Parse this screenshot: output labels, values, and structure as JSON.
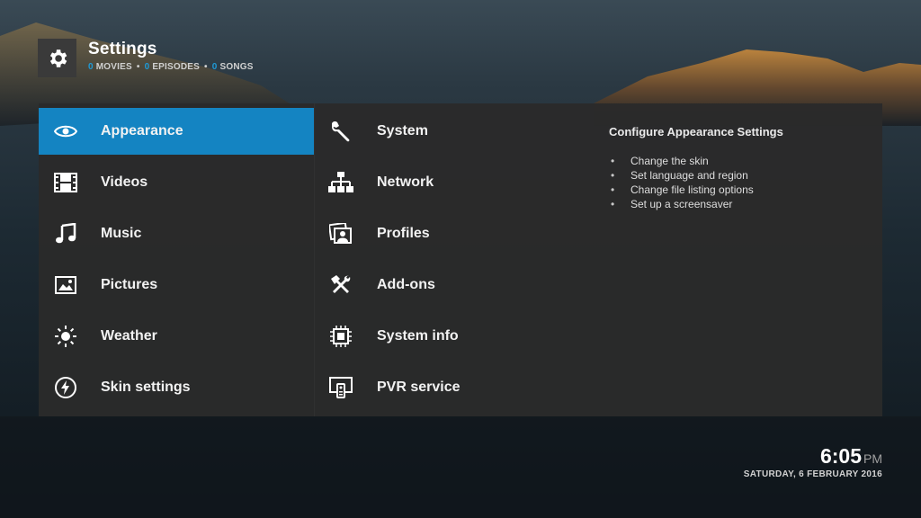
{
  "header": {
    "title": "Settings",
    "stats": [
      {
        "count": "0",
        "label": "MOVIES"
      },
      {
        "count": "0",
        "label": "EPISODES"
      },
      {
        "count": "0",
        "label": "SONGS"
      }
    ],
    "icon": "gear-icon"
  },
  "menu_left": [
    {
      "label": "Appearance",
      "icon": "eye-icon",
      "selected": true
    },
    {
      "label": "Videos",
      "icon": "film-icon"
    },
    {
      "label": "Music",
      "icon": "music-note-icon"
    },
    {
      "label": "Pictures",
      "icon": "picture-icon"
    },
    {
      "label": "Weather",
      "icon": "sun-icon"
    },
    {
      "label": "Skin settings",
      "icon": "lightning-icon"
    }
  ],
  "menu_right": [
    {
      "label": "System",
      "icon": "wrench-icon"
    },
    {
      "label": "Network",
      "icon": "network-icon"
    },
    {
      "label": "Profiles",
      "icon": "profiles-icon"
    },
    {
      "label": "Add-ons",
      "icon": "tools-icon"
    },
    {
      "label": "System info",
      "icon": "cpu-icon"
    },
    {
      "label": "PVR service",
      "icon": "tv-remote-icon"
    }
  ],
  "description": {
    "title": "Configure Appearance Settings",
    "items": [
      "Change the skin",
      "Set language and region",
      "Change file listing options",
      "Set up a screensaver"
    ]
  },
  "clock": {
    "time": "6:05",
    "ampm": "PM",
    "date": "SATURDAY, 6 FEBRUARY 2016"
  },
  "colors": {
    "accent": "#1484c2",
    "count_blue": "#1f9ad6",
    "panel": "#2a2a2a"
  }
}
